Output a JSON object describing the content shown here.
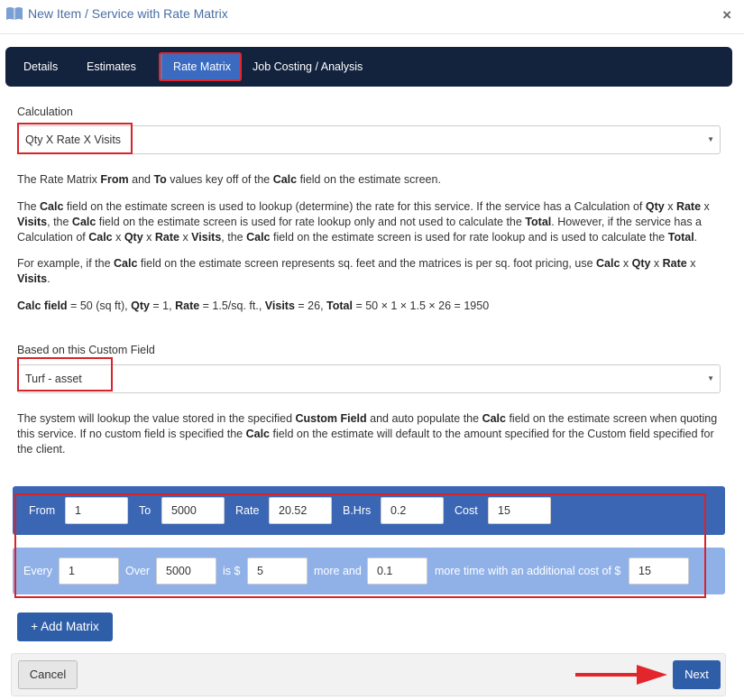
{
  "header": {
    "title": "New Item / Service with Rate Matrix",
    "close": "×"
  },
  "tabs": [
    {
      "label": "Details"
    },
    {
      "label": "Estimates"
    },
    {
      "label": "Rate Matrix",
      "active": true
    },
    {
      "label": "Job Costing / Analysis"
    }
  ],
  "calculation": {
    "label": "Calculation",
    "value": "Qty X Rate X Visits"
  },
  "info": {
    "p1_a": "The Rate Matrix ",
    "p1_from": "From",
    "p1_and": " and ",
    "p1_to": "To",
    "p1_b": " values key off of the ",
    "p1_calc": "Calc",
    "p1_c": " field on the estimate screen.",
    "p2_a": "The ",
    "p2_calc1": "Calc",
    "p2_b": " field on the estimate screen is used to lookup (determine) the rate for this service. If the service has a Calculation of ",
    "p2_qty1": "Qty",
    "p2_x1": " x ",
    "p2_rate1": "Rate",
    "p2_x2": " x ",
    "p2_visits1": "Visits",
    "p2_c": ", the ",
    "p2_calc2": "Calc",
    "p2_d": " field on the estimate screen is used for rate lookup only and not used to calculate the ",
    "p2_total1": "Total",
    "p2_e": ". However, if the service has a Calculation of ",
    "p2_calc3": "Calc",
    "p2_x3": " x ",
    "p2_qty2": "Qty",
    "p2_x4": " x ",
    "p2_rate2": "Rate",
    "p2_x5": " x ",
    "p2_visits2": "Visits",
    "p2_f": ", the ",
    "p2_calc4": "Calc",
    "p2_g": " field on the estimate screen is used for rate lookup and is used to calculate the ",
    "p2_total2": "Total",
    "p2_h": ".",
    "p3_a": "For example, if the ",
    "p3_calc1": "Calc",
    "p3_b": " field on the estimate screen represents sq. feet and the matrices is per sq. foot pricing, use ",
    "p3_calc2": "Calc",
    "p3_x1": " x ",
    "p3_qty": "Qty",
    "p3_x2": " x ",
    "p3_rate": "Rate",
    "p3_x3": " x ",
    "p3_visits": "Visits",
    "p3_c": ".",
    "p4_calcfield": "Calc field",
    "p4_a": " = 50 (sq ft), ",
    "p4_qty": "Qty",
    "p4_b": " = 1, ",
    "p4_rate": "Rate",
    "p4_c": " = 1.5/sq. ft., ",
    "p4_visits": "Visits",
    "p4_d": " = 26, ",
    "p4_total": "Total",
    "p4_e": " = 50 × 1 × 1.5 × 26 = 1950"
  },
  "custom_field": {
    "label": "Based on this Custom Field",
    "value": "Turf - asset"
  },
  "info2": {
    "a": "The system will lookup the value stored in the specified ",
    "cf": "Custom Field",
    "b": " and auto populate the ",
    "calc1": "Calc",
    "c": " field on the estimate screen when quoting this service. If no custom field is specified the ",
    "calc2": "Calc",
    "d": " field on the estimate will default to the amount specified for the Custom field specified for the client."
  },
  "matrix": {
    "from_label": "From",
    "from_value": "1",
    "to_label": "To",
    "to_value": "5000",
    "rate_label": "Rate",
    "rate_value": "20.52",
    "bhrs_label": "B.Hrs",
    "bhrs_value": "0.2",
    "cost_label": "Cost",
    "cost_value": "15",
    "every_label": "Every",
    "every_value": "1",
    "over_label": "Over",
    "over_value": "5000",
    "is_label": "is $",
    "is_value": "5",
    "more_label": "more and",
    "more_value": "0.1",
    "extra_label": "more time with an additional cost of $",
    "extra_value": "15"
  },
  "buttons": {
    "add_matrix": "+ Add Matrix",
    "cancel": "Cancel",
    "next": "Next"
  },
  "colors": {
    "nav_bg": "#13223d",
    "accent": "#2f5ea9",
    "matrix_dark": "#3a66b4",
    "matrix_light": "#8fb1e8",
    "highlight": "#d9232a"
  }
}
